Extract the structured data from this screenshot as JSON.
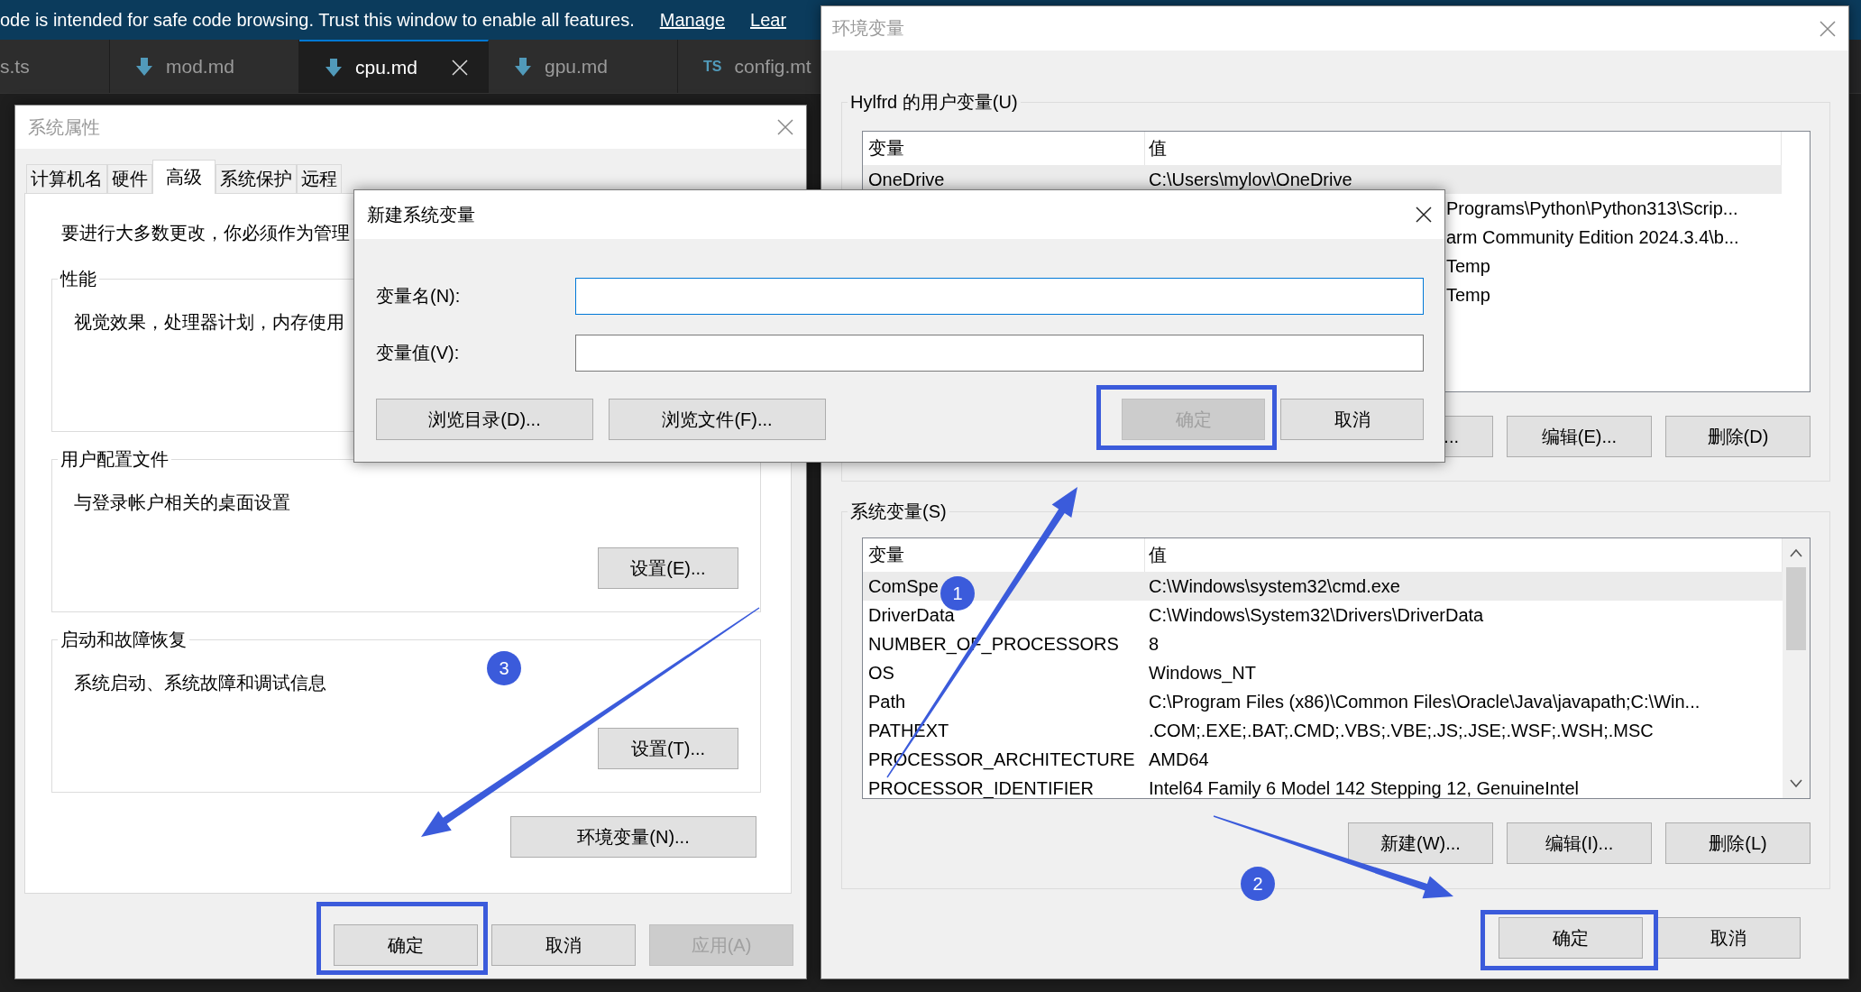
{
  "banner": {
    "message": "ode is intended for safe code browsing. Trust this window to enable all features.",
    "links": [
      "Manage",
      "Lear"
    ]
  },
  "editor_tabs": [
    {
      "label": "s.ts",
      "kind": "plain",
      "selected": false
    },
    {
      "label": "mod.md",
      "kind": "markdown",
      "selected": false
    },
    {
      "label": "cpu.md",
      "kind": "markdown",
      "selected": true
    },
    {
      "label": "gpu.md",
      "kind": "markdown",
      "selected": false
    },
    {
      "label": "config.mt",
      "kind": "typescript",
      "icon_text": "TS",
      "selected": false
    }
  ],
  "system_properties": {
    "title": "系统属性",
    "active": false,
    "tabs": [
      {
        "label": "计算机名",
        "selected": false
      },
      {
        "label": "硬件",
        "selected": false
      },
      {
        "label": "高级",
        "selected": true
      },
      {
        "label": "系统保护",
        "selected": false
      },
      {
        "label": "远程",
        "selected": false
      }
    ],
    "intro": "要进行大多数更改，你必须作为管理",
    "groups": [
      {
        "title": "性能",
        "description": "视觉效果，处理器计划，内存使用"
      },
      {
        "title": "用户配置文件",
        "description": "与登录帐户相关的桌面设置",
        "button": {
          "label": "设置(E)...",
          "disabled": false
        }
      },
      {
        "title": "启动和故障恢复",
        "description": "系统启动、系统故障和调试信息",
        "button": {
          "label": "设置(T)...",
          "disabled": false
        }
      }
    ],
    "env_button": {
      "label": "环境变量(N)...",
      "disabled": false
    },
    "buttons": [
      {
        "label": "确定",
        "disabled": false,
        "highlighted": true
      },
      {
        "label": "取消",
        "disabled": false
      },
      {
        "label": "应用(A)",
        "disabled": true
      }
    ]
  },
  "environment_variables": {
    "title": "环境变量",
    "active": false,
    "user_section": {
      "title": "Hylfrd 的用户变量(U)",
      "columns": [
        "变量",
        "值"
      ],
      "rows": [
        {
          "kind": "full",
          "name": "OneDrive",
          "value": "C:\\Users\\mylov\\OneDrive",
          "selected": true
        },
        {
          "kind": "covered",
          "value": "Programs\\Python\\Python313\\Scrip...",
          "selected": false
        },
        {
          "kind": "covered",
          "value": "arm Community Edition 2024.3.4\\b...",
          "selected": false
        },
        {
          "kind": "covered",
          "value": "Temp",
          "selected": false
        },
        {
          "kind": "covered",
          "value": "Temp",
          "selected": false
        }
      ],
      "buttons": [
        {
          "kind": "covered",
          "label": "...",
          "disabled": false
        },
        {
          "kind": "full",
          "label": "编辑(E)...",
          "disabled": false
        },
        {
          "kind": "full",
          "label": "删除(D)",
          "disabled": false
        }
      ]
    },
    "system_section": {
      "title": "系统变量(S)",
      "columns": [
        "变量",
        "值"
      ],
      "rows": [
        {
          "kind": "full",
          "name": "ComSpe",
          "value": "C:\\Windows\\system32\\cmd.exe",
          "selected": true
        },
        {
          "kind": "full",
          "name": "DriverData",
          "value": "C:\\Windows\\System32\\Drivers\\DriverData",
          "selected": false
        },
        {
          "kind": "full",
          "name": "NUMBER_OF_PROCESSORS",
          "value": "8",
          "selected": false
        },
        {
          "kind": "full",
          "name": "OS",
          "value": "Windows_NT",
          "selected": false
        },
        {
          "kind": "full",
          "name": "Path",
          "value": "C:\\Program Files (x86)\\Common Files\\Oracle\\Java\\javapath;C:\\Win...",
          "selected": false
        },
        {
          "kind": "full",
          "name": "PATHEXT",
          "value": ".COM;.EXE;.BAT;.CMD;.VBS;.VBE;.JS;.JSE;.WSF;.WSH;.MSC",
          "selected": false
        },
        {
          "kind": "full",
          "name": "PROCESSOR_ARCHITECTURE",
          "value": "AMD64",
          "selected": false
        },
        {
          "kind": "full",
          "name": "PROCESSOR_IDENTIFIER",
          "value": "Intel64 Family 6 Model 142 Stepping 12, GenuineIntel",
          "selected": false
        }
      ],
      "buttons": [
        {
          "kind": "full",
          "label": "新建(W)...",
          "disabled": false
        },
        {
          "kind": "full",
          "label": "编辑(I)...",
          "disabled": false
        },
        {
          "kind": "full",
          "label": "删除(L)",
          "disabled": false
        }
      ]
    },
    "buttons": [
      {
        "label": "确定",
        "disabled": false,
        "highlighted": true
      },
      {
        "label": "取消",
        "disabled": false
      }
    ]
  },
  "new_variable_dialog": {
    "title": "新建系统变量",
    "active": true,
    "fields": [
      {
        "label": "变量名(N):",
        "focused": true
      },
      {
        "label": "变量值(V):",
        "focused": false
      }
    ],
    "browse_buttons": [
      {
        "label": "浏览目录(D)...",
        "disabled": false
      },
      {
        "label": "浏览文件(F)...",
        "disabled": false
      }
    ],
    "buttons": [
      {
        "label": "确定",
        "disabled": true,
        "highlighted": true
      },
      {
        "label": "取消",
        "disabled": false
      }
    ]
  },
  "annotations": [
    {
      "number": "1"
    },
    {
      "number": "2"
    },
    {
      "number": "3"
    }
  ]
}
